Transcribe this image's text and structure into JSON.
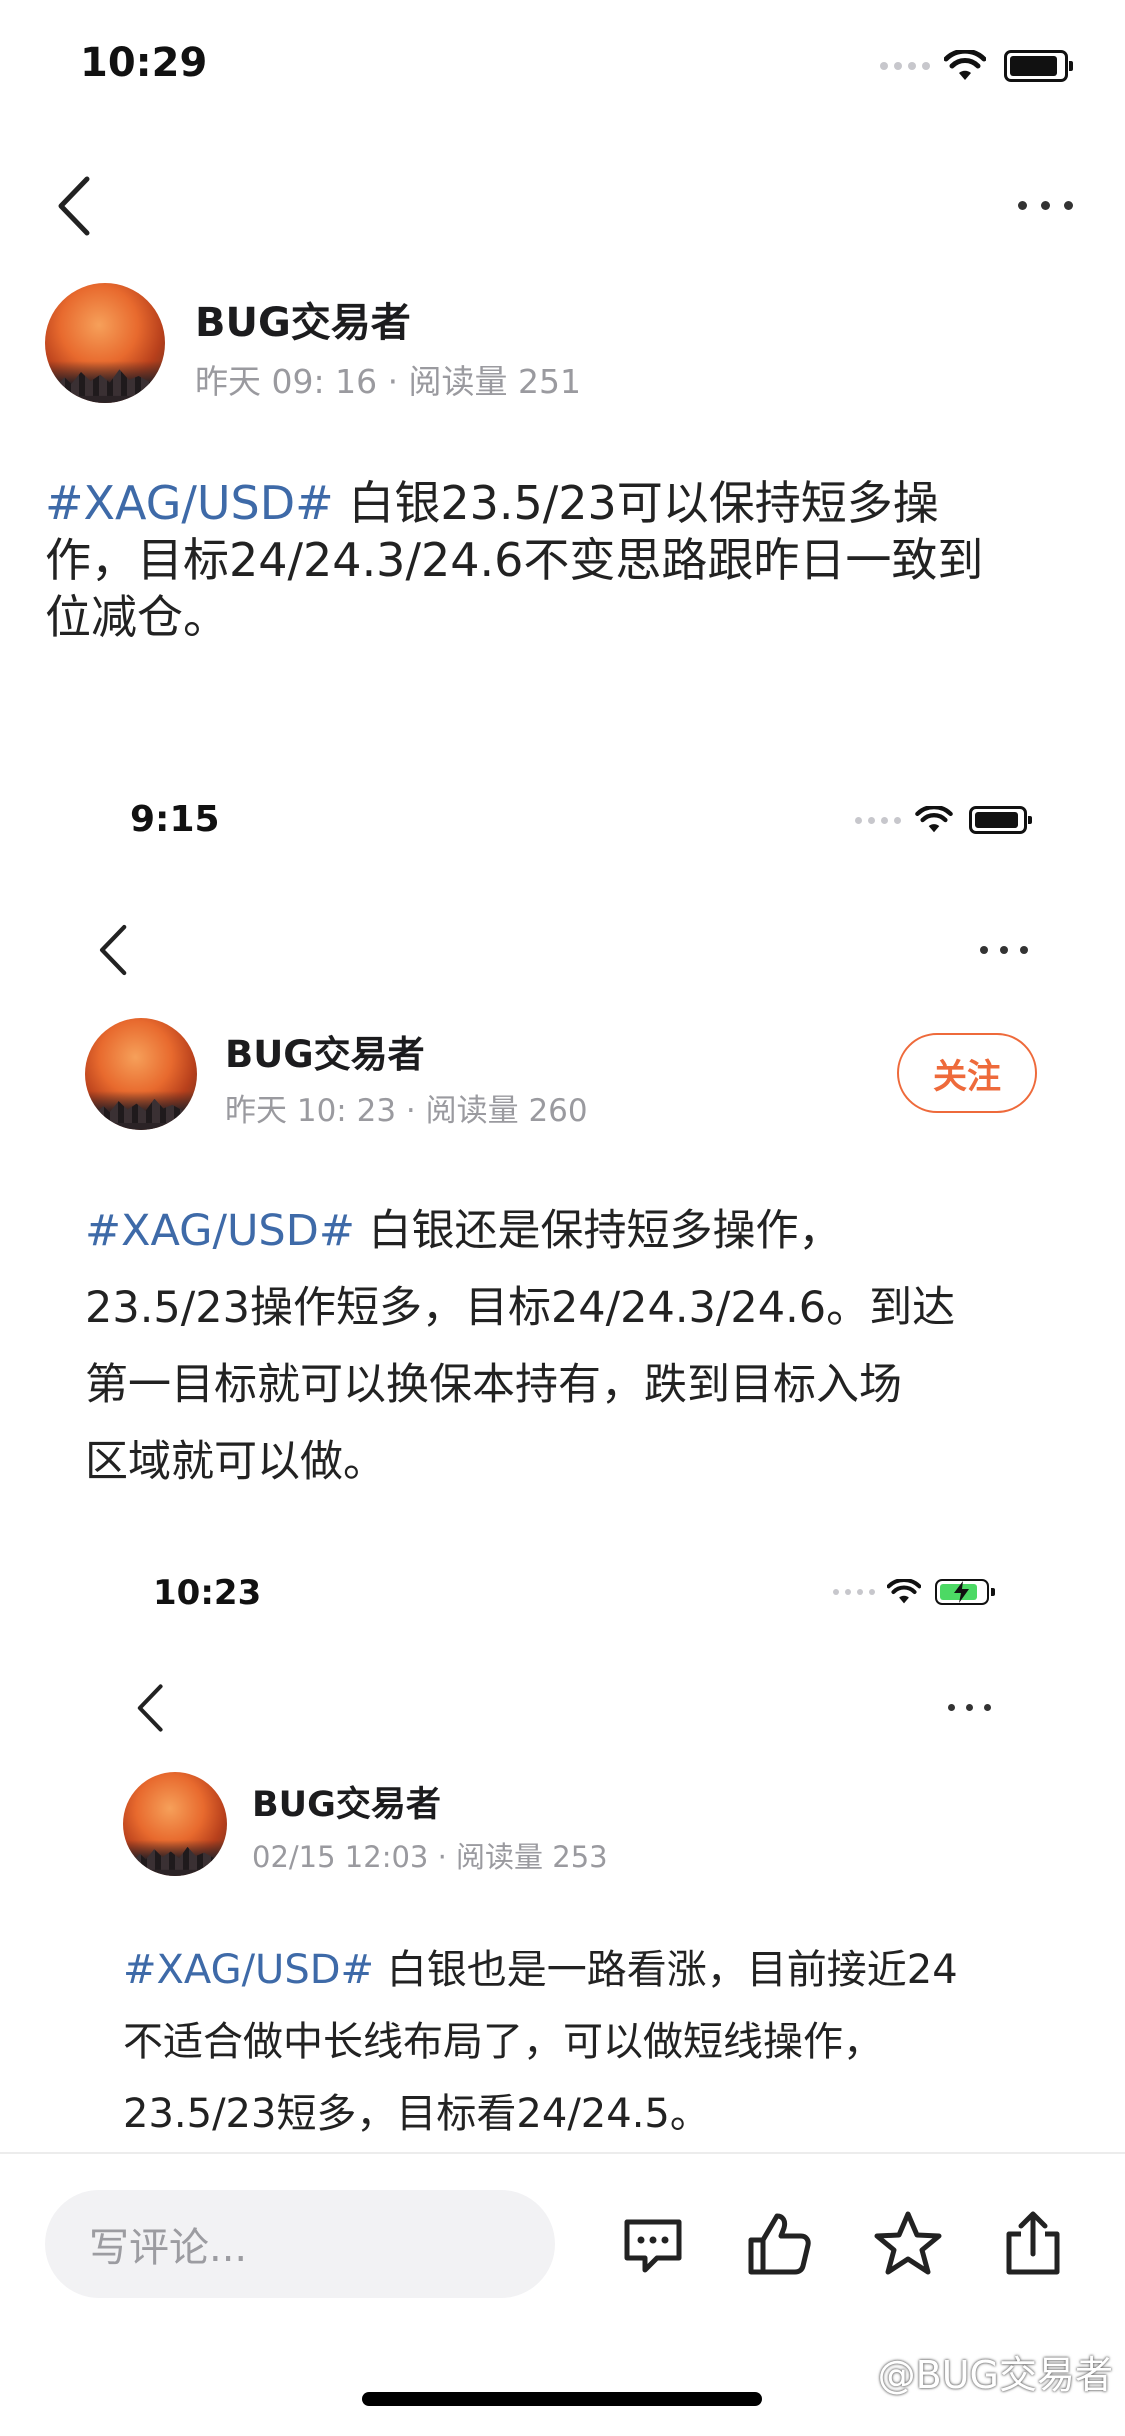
{
  "frames": [
    {
      "time": "10:29",
      "author": "BUG交易者",
      "meta": "昨天 09: 16 · 阅读量 251",
      "hashtag": "#XAG/USD#",
      "line1": " 白银23.5/23可以保持短多操",
      "line2": "作，目标24/24.3/24.6不变思路跟昨日一致到",
      "line3": "位减仓。"
    },
    {
      "time": "9:15",
      "author": "BUG交易者",
      "meta": "昨天 10: 23 · 阅读量 260",
      "follow_label": "关注",
      "hashtag": "#XAG/USD#",
      "line1": " 白银还是保持短多操作，",
      "line2": "23.5/23操作短多，目标24/24.3/24.6。到达",
      "line3": "第一目标就可以换保本持有，跌到目标入场",
      "line4": "区域就可以做。"
    },
    {
      "time": "10:23",
      "author": "BUG交易者",
      "meta": "02/15 12:03 · 阅读量 253",
      "hashtag": "#XAG/USD#",
      "line1": " 白银也是一路看涨，目前接近24",
      "line2": "不适合做中长线布局了，可以做短线操作，",
      "line3": "23.5/23短多，目标看24/24.5。"
    }
  ],
  "bottom_bar": {
    "comment_placeholder": "写评论...",
    "actions": [
      "comment-icon",
      "like-icon",
      "star-icon",
      "share-icon"
    ]
  },
  "watermark": "@BUG交易者",
  "colors": {
    "hashtag": "#3e6aa8",
    "follow": "#ee6a3b",
    "meta": "#9a9a9f"
  }
}
